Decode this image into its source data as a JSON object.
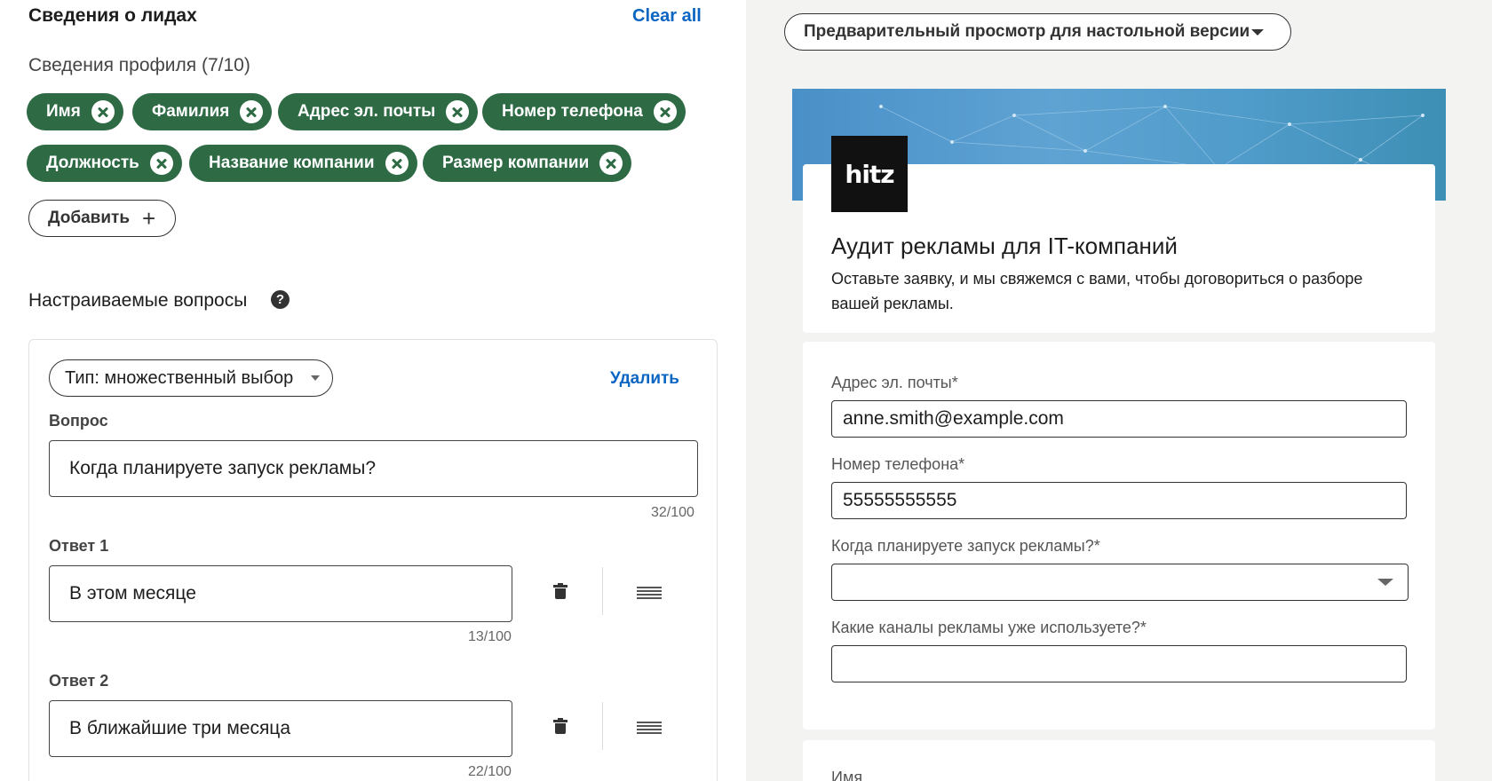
{
  "lead_details": {
    "title": "Сведения о лидах",
    "clear_all": "Clear all",
    "profile_title": "Сведения профиля (7/10)",
    "chips": [
      "Имя",
      "Фамилия",
      "Адрес эл. почты",
      "Номер телефона",
      "Должность",
      "Название компании",
      "Размер компании"
    ],
    "add_label": "Добавить",
    "add_icon": "+"
  },
  "custom_questions": {
    "title": "Настраиваемые вопросы",
    "help_icon": "?",
    "type_label": "Тип: множественный выбор",
    "delete_label": "Удалить",
    "question_label": "Вопрос",
    "question_value": "Когда планируете запуск рекламы?",
    "question_counter": "32/100",
    "answers": [
      {
        "label": "Ответ 1",
        "value": "В этом месяце",
        "counter": "13/100"
      },
      {
        "label": "Ответ 2",
        "value": "В ближайшие три месяца",
        "counter": "22/100"
      }
    ]
  },
  "preview": {
    "dropdown_label": "Предварительный просмотр для настольной версии",
    "logo_text": "hitz",
    "form_title": "Аудит рекламы для IT-компаний",
    "form_subtitle": "Оставьте заявку, и мы свяжемся с вами, чтобы договориться о разборе вашей рекламы.",
    "fields": [
      {
        "label": "Адрес эл. почты*",
        "value": "anne.smith@example.com"
      },
      {
        "label": "Номер телефона*",
        "value": "55555555555"
      },
      {
        "label": "Когда планируете запуск рекламы?*",
        "value": ""
      },
      {
        "label": "Какие каналы рекламы уже используете?*",
        "value": ""
      }
    ],
    "next_field_label": "Имя"
  },
  "colors": {
    "chip_green": "#2e6b45",
    "link_blue": "#0a66c2",
    "banner_blue": "#4a90c8",
    "preview_bg": "#f3f3f2"
  }
}
